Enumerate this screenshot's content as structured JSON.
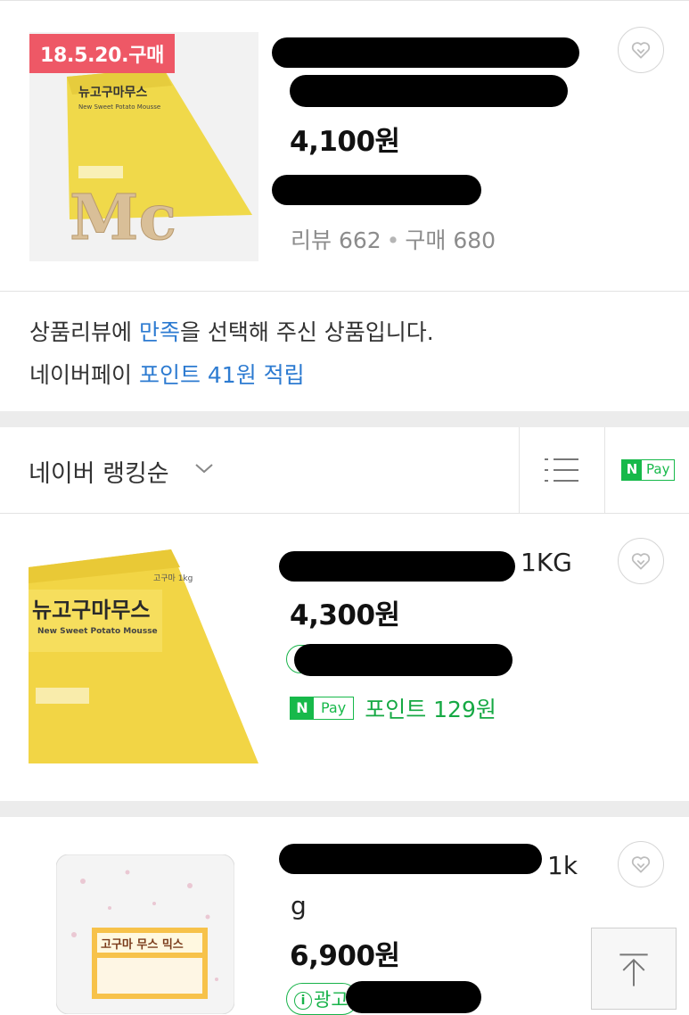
{
  "product1": {
    "badge": "18.5.20.구매",
    "price": "4,100원",
    "reviews_label": "리뷰 662",
    "separator": "•",
    "purchases_label": "구매 680",
    "thumb": {
      "label": "뉴고구마무스",
      "sub": "New Sweet Potato Mousse",
      "deco": "Mc"
    }
  },
  "notice": {
    "line1_before": "상품리뷰에 ",
    "line1_highlight": "만족",
    "line1_after": "을 선택해 주신 상품입니다.",
    "line2_before": "네이버페이 ",
    "line2_highlight": "포인트 41원 적립"
  },
  "sort": {
    "label": "네이버 랭킹순",
    "npay_n": "N",
    "npay_pay": "Pay"
  },
  "product2": {
    "title_tail": "1KG",
    "price": "4,300원",
    "npay_n": "N",
    "npay_pay": "Pay",
    "point_text": "포인트 129원",
    "thumb": {
      "label": "뉴고구마무스",
      "sub": "New Sweet Potato Mousse",
      "brand_small": "고구마 1kg"
    }
  },
  "product3": {
    "title_tail_1": "1k",
    "title_tail_2": "g",
    "price": "6,900원",
    "ad_label": "광고",
    "thumb": {
      "label": "고구마 무스 믹스"
    }
  },
  "colors": {
    "accent_green": "#17b94a",
    "link_blue": "#2d7bd1",
    "badge_red": "#ee5866"
  },
  "icons": [
    "heart-icon",
    "list-view-icon",
    "chevron-down-icon",
    "scroll-top-icon",
    "info-icon"
  ]
}
